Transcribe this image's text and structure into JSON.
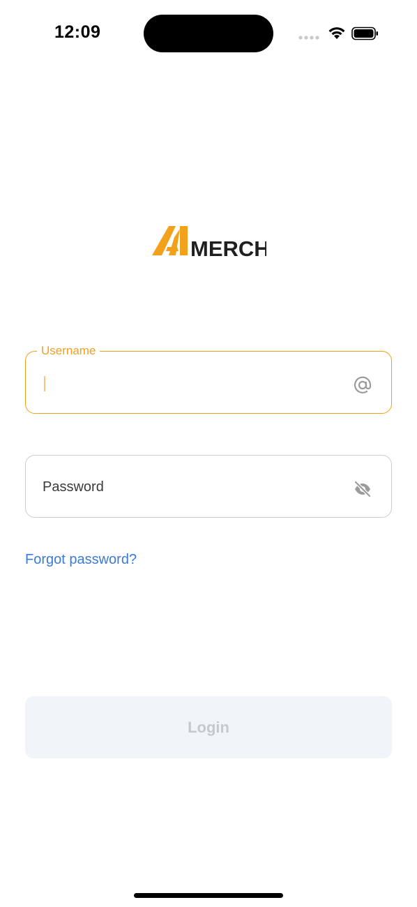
{
  "status_bar": {
    "time": "12:09",
    "icons": [
      "signal-dots-icon",
      "wifi-icon",
      "battery-icon"
    ]
  },
  "logo": {
    "text": "MERCH",
    "brand_color": "#f2a21a",
    "text_color": "#1f1f1f"
  },
  "form": {
    "username": {
      "label": "Username",
      "value": "",
      "icon": "at-sign-icon",
      "focused": true
    },
    "password": {
      "label": "Password",
      "value": "",
      "icon": "eye-off-icon"
    },
    "forgot_link": "Forgot password?",
    "login_label": "Login",
    "login_enabled": false
  },
  "colors": {
    "accent": "#f2a21a",
    "link": "#3a7bd5",
    "disabled_bg": "#f1f4f8",
    "disabled_text": "#c4c9d0"
  }
}
